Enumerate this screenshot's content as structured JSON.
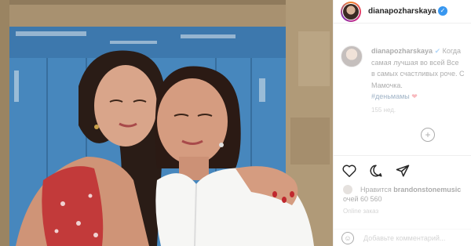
{
  "post": {
    "username": "dianapozharskaya",
    "verified_icon": "verified-badge-icon",
    "caption": {
      "username": "dianapozharskaya",
      "verified_mark": "✔",
      "lines": [
        "Когда",
        "самая лучшая во всей Все",
        "в самых счастливых роче. С",
        "Мамочка."
      ],
      "hashtag": "#деньмамы",
      "heart": "❤"
    },
    "time_ago": "155 нед.",
    "likes_prefix": "Нравится",
    "likes_user": "brandonstonemusic",
    "views": "очей 60 560",
    "date": "Оnline заказ",
    "comment_placeholder": "Добавьте комментарий..."
  },
  "icons": {
    "like": "heart-icon",
    "comment": "comment-icon",
    "share": "share-icon",
    "emoji": "emoji-icon",
    "refresh": "refresh-icon"
  },
  "colors": {
    "accent": "#3897f0",
    "text": "#262626",
    "muted": "#8e8e8e",
    "border": "#efefef"
  }
}
